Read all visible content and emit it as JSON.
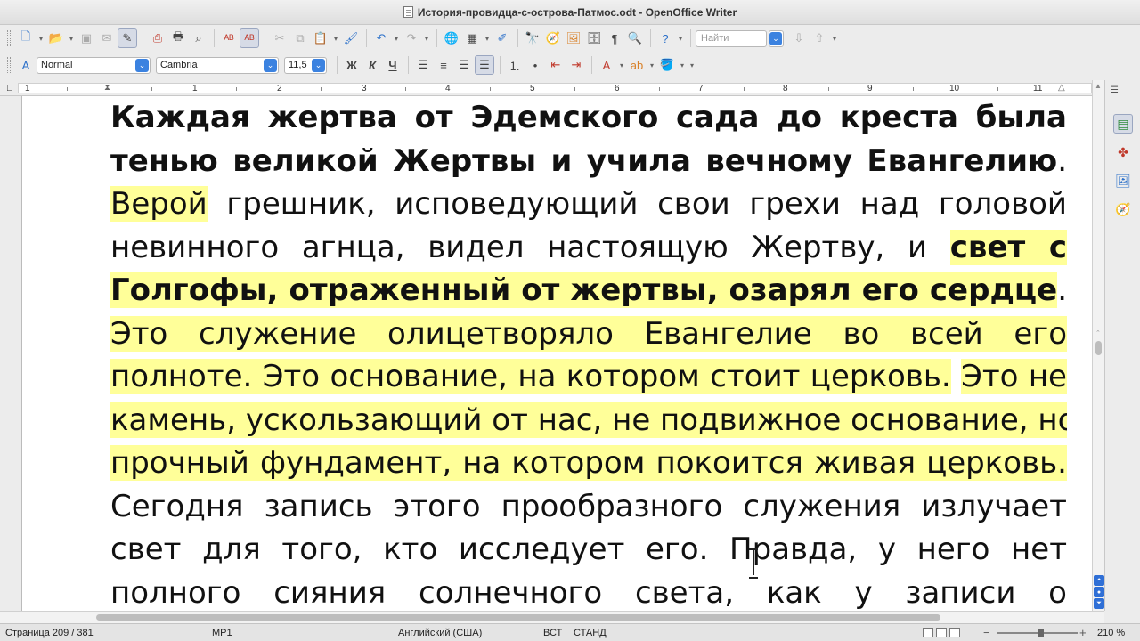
{
  "window": {
    "title": "История-провидца-с-острова-Патмос.odt - OpenOffice Writer"
  },
  "toolbar_standard": {
    "find_placeholder": "Найти"
  },
  "toolbar_format": {
    "paragraph_style": "Normal",
    "font_name": "Cambria",
    "font_size": "11,5",
    "bold_label": "Ж",
    "italic_label": "К",
    "underline_label": "Ч"
  },
  "ruler": {
    "numbers": [
      "1",
      "1",
      "2",
      "3",
      "4",
      "5",
      "6",
      "7",
      "8",
      "9",
      "10",
      "11"
    ]
  },
  "document": {
    "lines": [
      {
        "segments": [
          {
            "text": "Каждая жертва от Эдемского сада до креста была",
            "bold": true
          }
        ]
      },
      {
        "segments": [
          {
            "text": "тенью великой Жертвы и учила вечному Евангелию",
            "bold": true
          },
          {
            "text": "."
          }
        ]
      },
      {
        "segments": [
          {
            "text": "Верой",
            "hl": true
          },
          {
            "text": " грешник, исповедующий свои грехи над головой"
          }
        ]
      },
      {
        "segments": [
          {
            "text": "невинного агнца, видел настоящую Жертву, и  "
          },
          {
            "text": "свет  с",
            "bold": true,
            "hl": true
          }
        ]
      },
      {
        "segments": [
          {
            "text": "Голгофы, отраженный от жертвы, озарял его сердце",
            "bold": true,
            "hl": true
          },
          {
            "text": "."
          }
        ]
      },
      {
        "segments": [
          {
            "text": "Это служение олицетворяло Евангелие во всей его",
            "hl": true
          }
        ]
      },
      {
        "segments": [
          {
            "text": "полноте. Это основание, на котором стоит церковь.",
            "hl": true
          },
          {
            "text": " "
          },
          {
            "text": "Это не",
            "hl": true
          }
        ]
      },
      {
        "segments": [
          {
            "text": "камень, ускользающий от нас, не подвижное основание, но",
            "hl": true
          }
        ]
      },
      {
        "segments": [
          {
            "text": "прочный фундамент, на котором покоится живая церковь.",
            "hl": true
          }
        ]
      },
      {
        "segments": [
          {
            "text": "Сегодня запись этого прообразного служения излучает"
          }
        ]
      },
      {
        "segments": [
          {
            "text": "свет для того, кто исследует его. Правда, у него нет"
          }
        ]
      },
      {
        "segments": [
          {
            "text": "полного сияния солнечного света, как у записи о"
          }
        ]
      }
    ]
  },
  "statusbar": {
    "page": "Страница  209 / 381",
    "page_style": "МР1",
    "language": "Английский (США)",
    "insert_mode": "ВСТ",
    "selection_mode": "СТАНД",
    "zoom": "210 %"
  },
  "colors": {
    "highlight": "#ffff99",
    "accent": "#3b82e0"
  }
}
